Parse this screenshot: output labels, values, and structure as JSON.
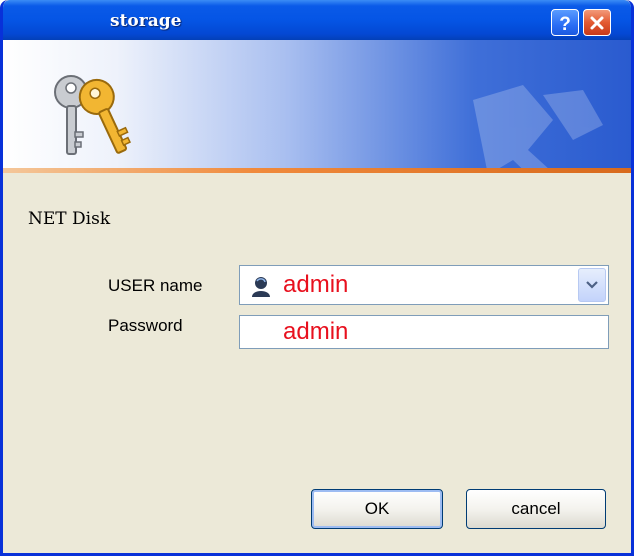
{
  "window": {
    "title": "storage",
    "help_icon": "help-icon",
    "close_icon": "close-icon"
  },
  "banner": {
    "icon": "keys-icon",
    "accent_color": "#f08a3c"
  },
  "form": {
    "heading": "NET Disk",
    "username_label": "USER name",
    "username_value": "admin",
    "username_icon": "user-icon",
    "password_label": "Password",
    "password_value": "admin",
    "value_color": "#e8101e"
  },
  "buttons": {
    "ok_label": "OK",
    "cancel_label": "cancel"
  }
}
